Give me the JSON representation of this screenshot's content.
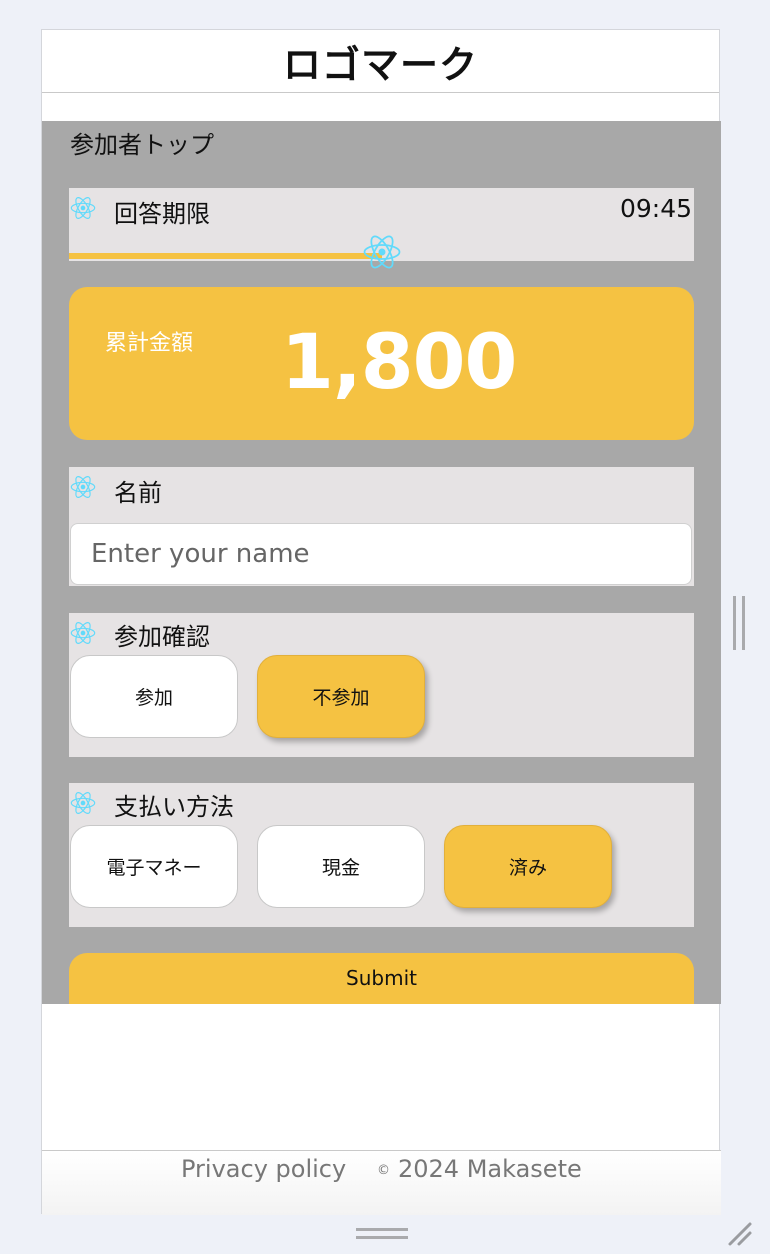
{
  "header": {
    "logo_text": "ロゴマーク"
  },
  "page": {
    "title": "参加者トップ"
  },
  "deadline": {
    "label": "回答期限",
    "remaining_time": "09:45",
    "progress_fraction": 0.5,
    "icon": "react-icon"
  },
  "total": {
    "label": "累計金額",
    "amount": "1,800"
  },
  "name": {
    "label": "名前",
    "placeholder": "Enter your name",
    "value": ""
  },
  "attendance": {
    "label": "参加確認",
    "options": [
      "参加",
      "不参加"
    ],
    "selected": "不参加"
  },
  "payment": {
    "label": "支払い方法",
    "options": [
      "電子マネー",
      "現金",
      "済み"
    ],
    "selected": "済み"
  },
  "submit": {
    "label": "Submit"
  },
  "footer": {
    "privacy_label": "Privacy policy",
    "copyright_symbol": "©",
    "copyright_text": "2024 Makasete"
  },
  "colors": {
    "accent": "#f5c242",
    "panel": "#a8a8a8",
    "card": "#e6e3e4",
    "react_icon": "#61dafb"
  }
}
